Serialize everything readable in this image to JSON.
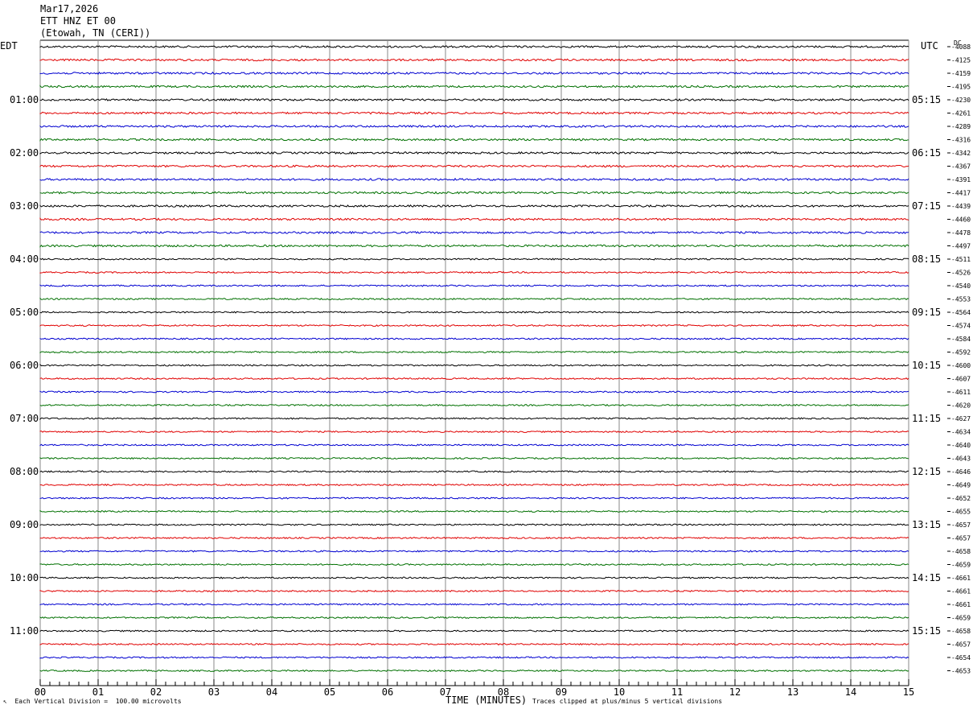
{
  "header": {
    "date": "Mar17,2026",
    "station": "ETT HNZ ET 00",
    "location": "(Etowah, TN (CERI))"
  },
  "labels": {
    "left_tz": "EDT",
    "right_tz": "UTC",
    "dc": "DC",
    "xlabel": "TIME (MINUTES)",
    "scale_note": "Each Vertical Division =  100.00 microvolts",
    "clip_note": "Traces clipped at plus/minus 5 vertical divisions",
    "footer_mark": "↖"
  },
  "chart_data": {
    "type": "line",
    "title": "ETT HNZ ET 00",
    "xlabel": "TIME (MINUTES)",
    "xlim": [
      0,
      15
    ],
    "x_ticks": [
      "00",
      "01",
      "02",
      "03",
      "04",
      "05",
      "06",
      "07",
      "08",
      "09",
      "10",
      "11",
      "12",
      "13",
      "14",
      "15"
    ],
    "grid": true,
    "trace_colors": [
      "#000000",
      "#e00000",
      "#0000d0",
      "#007000"
    ],
    "left_hour_labels": [
      "01:00",
      "02:00",
      "03:00",
      "04:00",
      "05:00",
      "06:00",
      "07:00",
      "08:00",
      "09:00",
      "10:00",
      "11:00"
    ],
    "right_hour_labels": [
      "05:15",
      "06:15",
      "07:15",
      "08:15",
      "09:15",
      "10:15",
      "11:15",
      "12:15",
      "13:15",
      "14:15",
      "15:15"
    ],
    "dc_offsets": [
      "-4088",
      "-4125",
      "-4159",
      "-4195",
      "-4230",
      "-4261",
      "-4289",
      "-4316",
      "-4342",
      "-4367",
      "-4391",
      "-4417",
      "-4439",
      "-4460",
      "-4478",
      "-4497",
      "-4511",
      "-4526",
      "-4540",
      "-4553",
      "-4564",
      "-4574",
      "-4584",
      "-4592",
      "-4600",
      "-4607",
      "-4611",
      "-4620",
      "-4627",
      "-4634",
      "-4640",
      "-4643",
      "-4646",
      "-4649",
      "-4652",
      "-4655",
      "-4657",
      "-4657",
      "-4658",
      "-4659",
      "-4661",
      "-4661",
      "-4661",
      "-4659",
      "-4658",
      "-4657",
      "-4654",
      "-4653"
    ]
  }
}
